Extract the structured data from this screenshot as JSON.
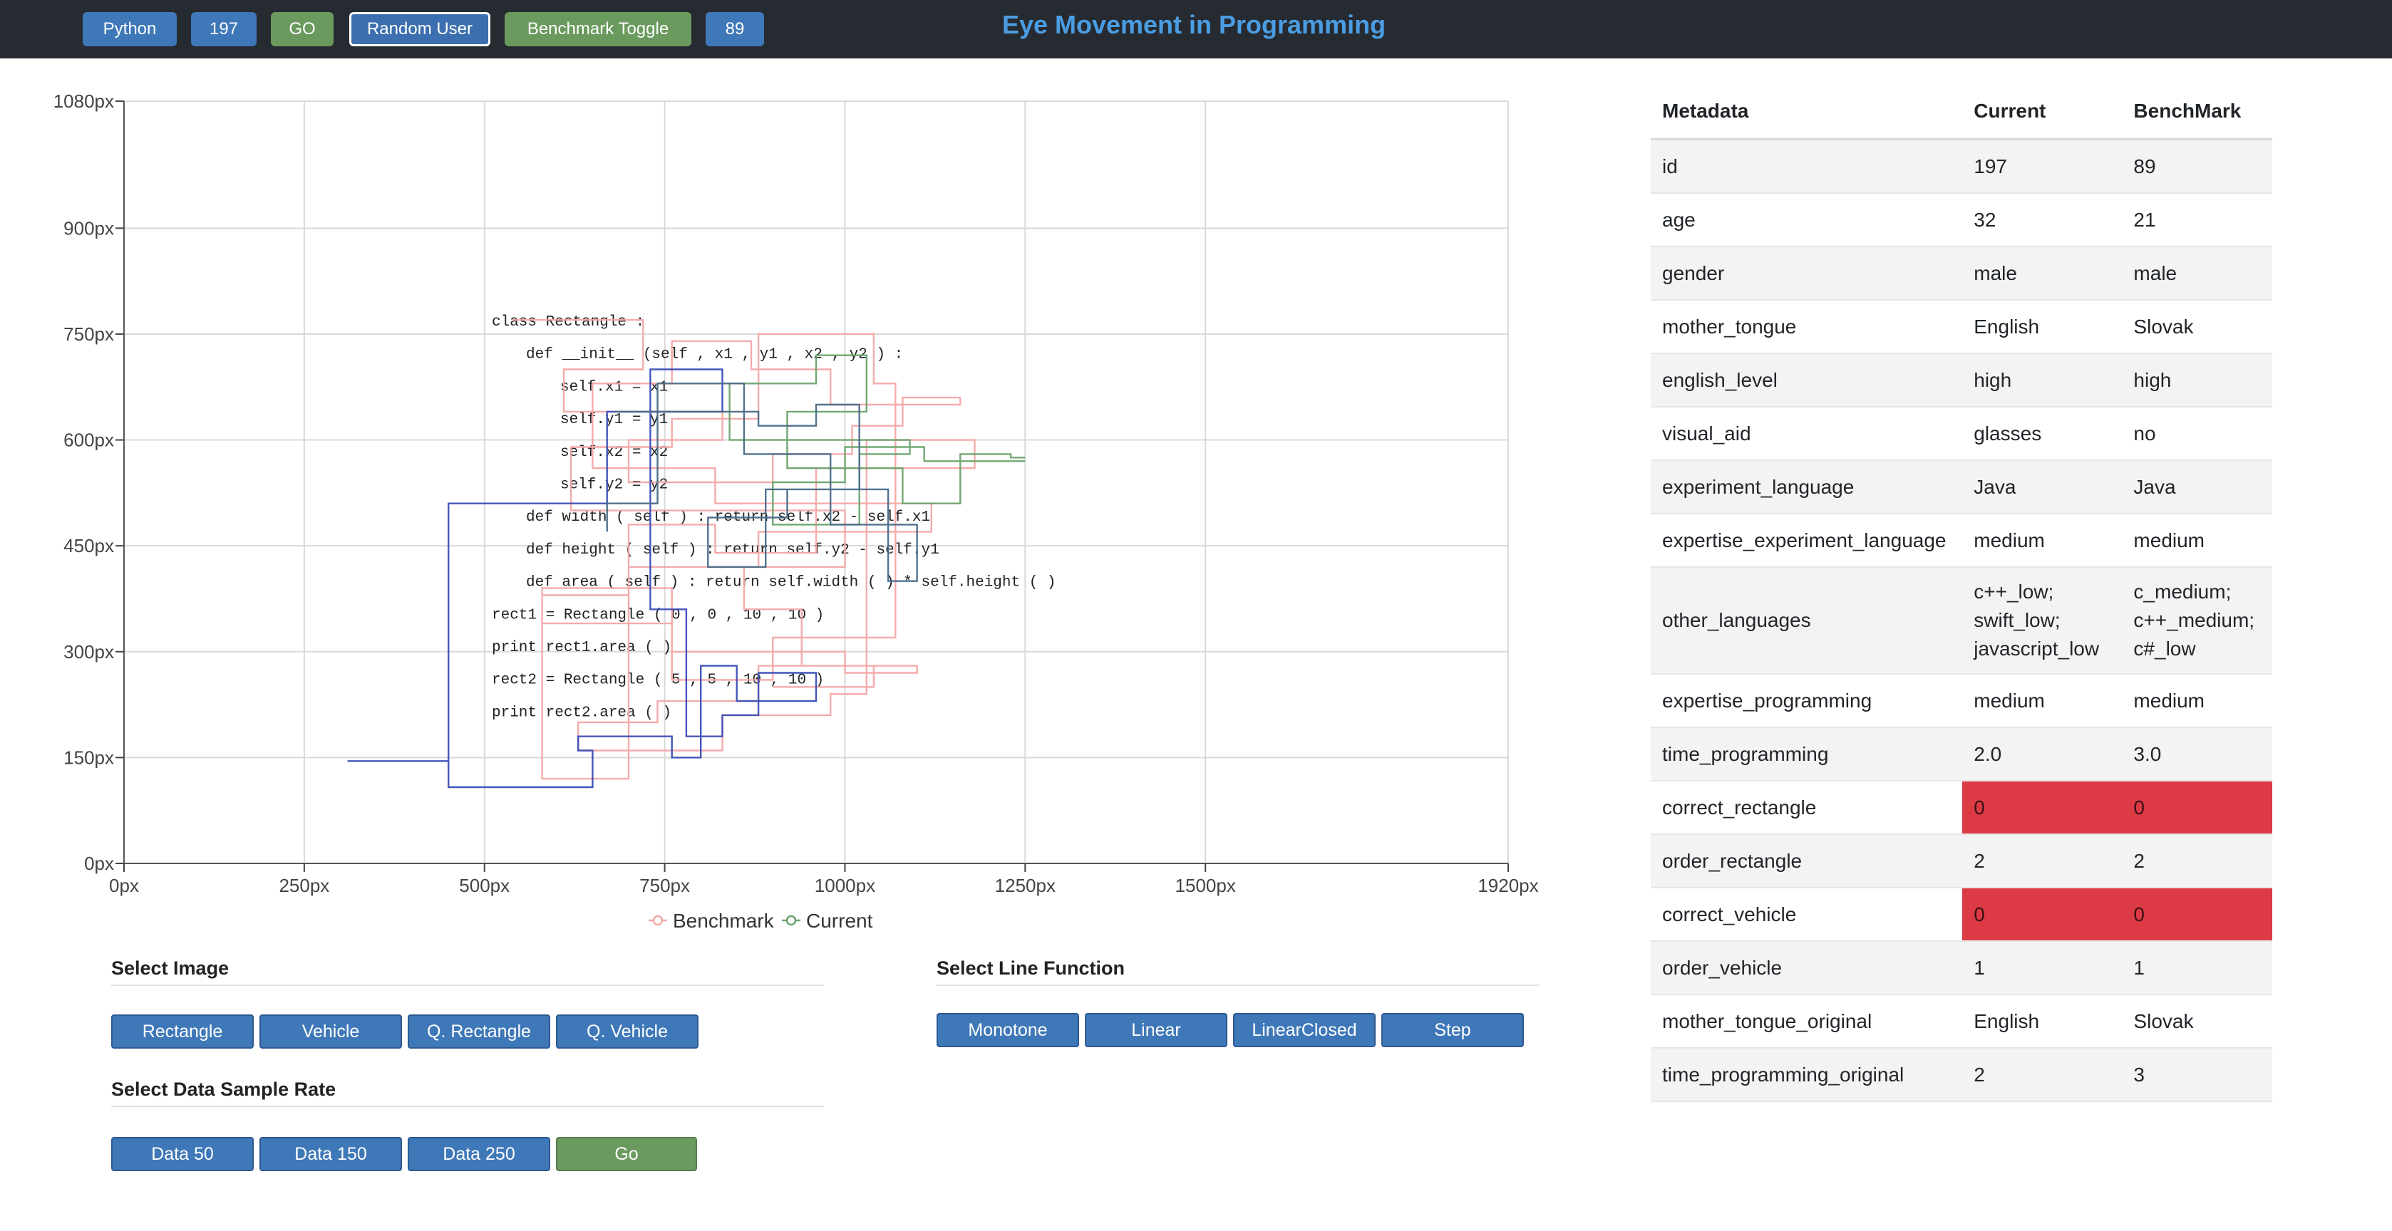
{
  "navbar": {
    "language_button": "Python",
    "current_id_button": "197",
    "go_button": "GO",
    "random_user_button": "Random User",
    "benchmark_toggle_button": "Benchmark Toggle",
    "benchmark_id_button": "89",
    "title": "Eye Movement in Programming",
    "colors": {
      "bar": "#262a31",
      "title": "#4a9de2",
      "blue": "#3f78b8",
      "green": "#6b9a5e"
    }
  },
  "chart_data": {
    "type": "line",
    "x_ticks": [
      "0px",
      "250px",
      "500px",
      "750px",
      "1000px",
      "1250px",
      "1500px",
      "1920px"
    ],
    "y_ticks": [
      "0px",
      "150px",
      "300px",
      "450px",
      "600px",
      "750px",
      "900px",
      "1080px"
    ],
    "xlim": [
      0,
      1920
    ],
    "ylim": [
      0,
      1080
    ],
    "grid": true,
    "legend_position": "bottom-center",
    "series": [
      {
        "name": "Benchmark",
        "color": "#f4a7a7",
        "curve": "step",
        "points": [
          [
            540,
            770
          ],
          [
            720,
            770
          ],
          [
            720,
            700
          ],
          [
            610,
            700
          ],
          [
            610,
            640
          ],
          [
            830,
            640
          ],
          [
            830,
            600
          ],
          [
            700,
            600
          ],
          [
            700,
            540
          ],
          [
            900,
            540
          ],
          [
            900,
            580
          ],
          [
            1010,
            580
          ],
          [
            1010,
            620
          ],
          [
            1080,
            620
          ],
          [
            1080,
            660
          ],
          [
            1160,
            660
          ],
          [
            1160,
            650
          ],
          [
            980,
            650
          ],
          [
            980,
            700
          ],
          [
            870,
            700
          ],
          [
            870,
            740
          ],
          [
            760,
            740
          ],
          [
            760,
            680
          ],
          [
            650,
            680
          ],
          [
            650,
            560
          ],
          [
            820,
            560
          ],
          [
            820,
            510
          ],
          [
            1120,
            510
          ],
          [
            1120,
            470
          ],
          [
            880,
            470
          ],
          [
            880,
            420
          ],
          [
            700,
            420
          ],
          [
            700,
            380
          ],
          [
            580,
            380
          ],
          [
            580,
            340
          ],
          [
            760,
            340
          ],
          [
            760,
            300
          ],
          [
            1000,
            300
          ],
          [
            1000,
            270
          ],
          [
            1100,
            270
          ],
          [
            1100,
            280
          ],
          [
            880,
            280
          ],
          [
            880,
            230
          ],
          [
            740,
            230
          ],
          [
            740,
            200
          ],
          [
            630,
            200
          ],
          [
            630,
            160
          ],
          [
            830,
            160
          ],
          [
            830,
            210
          ],
          [
            980,
            210
          ],
          [
            980,
            240
          ],
          [
            1030,
            240
          ],
          [
            1030,
            600
          ],
          [
            1180,
            600
          ],
          [
            1180,
            560
          ],
          [
            960,
            560
          ],
          [
            960,
            440
          ],
          [
            820,
            440
          ],
          [
            820,
            480
          ],
          [
            700,
            480
          ],
          [
            700,
            120
          ],
          [
            580,
            120
          ],
          [
            580,
            390
          ],
          [
            760,
            390
          ],
          [
            760,
            260
          ],
          [
            900,
            260
          ],
          [
            900,
            320
          ],
          [
            1070,
            320
          ],
          [
            1070,
            680
          ],
          [
            1040,
            680
          ],
          [
            1040,
            750
          ],
          [
            880,
            750
          ],
          [
            880,
            630
          ],
          [
            760,
            630
          ],
          [
            760,
            590
          ],
          [
            620,
            590
          ],
          [
            620,
            500
          ],
          [
            1000,
            500
          ],
          [
            1000,
            420
          ],
          [
            860,
            420
          ],
          [
            860,
            360
          ],
          [
            940,
            360
          ],
          [
            940,
            280
          ],
          [
            1040,
            280
          ],
          [
            1040,
            250
          ],
          [
            900,
            250
          ]
        ]
      },
      {
        "name": "Current",
        "color": "#6aa36b",
        "curve": "step",
        "points": [
          [
            1250,
            570
          ],
          [
            1110,
            570
          ],
          [
            1110,
            590
          ],
          [
            1000,
            590
          ],
          [
            1000,
            540
          ],
          [
            900,
            540
          ],
          [
            900,
            480
          ],
          [
            1020,
            480
          ],
          [
            1020,
            580
          ],
          [
            1090,
            580
          ],
          [
            1090,
            600
          ],
          [
            840,
            600
          ],
          [
            840,
            680
          ],
          [
            960,
            680
          ],
          [
            960,
            720
          ],
          [
            1030,
            720
          ],
          [
            1030,
            640
          ],
          [
            920,
            640
          ],
          [
            920,
            560
          ],
          [
            1080,
            560
          ],
          [
            1080,
            510
          ],
          [
            1160,
            510
          ],
          [
            1160,
            580
          ],
          [
            1230,
            580
          ],
          [
            1230,
            575
          ],
          [
            1250,
            575
          ]
        ]
      },
      {
        "name": "",
        "color": "#3a4db6",
        "curve": "step",
        "points": [
          [
            310,
            145
          ],
          [
            450,
            145
          ],
          [
            450,
            108
          ],
          [
            650,
            108
          ],
          [
            650,
            160
          ],
          [
            630,
            160
          ],
          [
            630,
            180
          ],
          [
            760,
            180
          ],
          [
            760,
            150
          ],
          [
            800,
            150
          ],
          [
            800,
            280
          ],
          [
            850,
            280
          ],
          [
            850,
            230
          ],
          [
            960,
            230
          ],
          [
            960,
            270
          ],
          [
            880,
            270
          ],
          [
            880,
            210
          ],
          [
            830,
            210
          ],
          [
            830,
            180
          ],
          [
            780,
            180
          ],
          [
            780,
            360
          ],
          [
            730,
            360
          ],
          [
            730,
            700
          ],
          [
            830,
            700
          ],
          [
            830,
            640
          ],
          [
            670,
            640
          ],
          [
            670,
            510
          ],
          [
            450,
            510
          ],
          [
            450,
            110
          ]
        ]
      },
      {
        "name": "",
        "color": "#4a6a88",
        "curve": "step",
        "points": [
          [
            680,
            640
          ],
          [
            880,
            640
          ],
          [
            880,
            620
          ],
          [
            960,
            620
          ],
          [
            960,
            650
          ],
          [
            1020,
            650
          ],
          [
            1020,
            530
          ],
          [
            920,
            530
          ],
          [
            920,
            490
          ],
          [
            810,
            490
          ],
          [
            810,
            420
          ],
          [
            890,
            420
          ],
          [
            890,
            530
          ],
          [
            1060,
            530
          ],
          [
            1060,
            400
          ],
          [
            1100,
            400
          ],
          [
            1100,
            480
          ],
          [
            980,
            480
          ],
          [
            980,
            580
          ],
          [
            860,
            580
          ],
          [
            860,
            680
          ],
          [
            740,
            680
          ],
          [
            740,
            510
          ],
          [
            670,
            510
          ],
          [
            670,
            470
          ]
        ]
      }
    ]
  },
  "code_lines": [
    "class Rectangle :",
    "def __init__ (self , x1 , y1 , x2 , y2 ) :",
    "self.x1 = x1",
    "self.y1 = y1",
    "self.x2 = x2",
    "self.y2 = y2",
    "def width ( self ) : return self.x2 - self.x1",
    "def height ( self ) : return self.y2 - self.y1",
    "def area ( self ) : return self.width ( ) * self.height ( )",
    "rect1 = Rectangle ( 0 , 0 , 10 , 10 )",
    "print rect1.area ( )",
    "rect2 = Rectangle ( 5 , 5 , 10 , 10 )",
    "print rect2.area ( )"
  ],
  "select_image": {
    "title": "Select Image",
    "buttons": [
      "Rectangle",
      "Vehicle",
      "Q. Rectangle",
      "Q. Vehicle"
    ]
  },
  "select_line_function": {
    "title": "Select Line Function",
    "buttons": [
      "Monotone",
      "Linear",
      "LinearClosed",
      "Step"
    ]
  },
  "select_sample_rate": {
    "title": "Select Data Sample Rate",
    "buttons": [
      "Data 50",
      "Data 150",
      "Data 250",
      "Go"
    ]
  },
  "metadata_table": {
    "headers": [
      "Metadata",
      "Current",
      "BenchMark"
    ],
    "alert_color": "#dc3b45",
    "rows": [
      {
        "key": "id",
        "current": "197",
        "benchmark": "89",
        "alert": false
      },
      {
        "key": "age",
        "current": "32",
        "benchmark": "21",
        "alert": false
      },
      {
        "key": "gender",
        "current": "male",
        "benchmark": "male",
        "alert": false
      },
      {
        "key": "mother_tongue",
        "current": "English",
        "benchmark": "Slovak",
        "alert": false
      },
      {
        "key": "english_level",
        "current": "high",
        "benchmark": "high",
        "alert": false
      },
      {
        "key": "visual_aid",
        "current": "glasses",
        "benchmark": "no",
        "alert": false
      },
      {
        "key": "experiment_language",
        "current": "Java",
        "benchmark": "Java",
        "alert": false
      },
      {
        "key": "expertise_experiment_language",
        "current": "medium",
        "benchmark": "medium",
        "alert": false
      },
      {
        "key": "other_languages",
        "current": "c++_low; swift_low; javascript_low",
        "benchmark": "c_medium; c++_medium; c#_low",
        "alert": false
      },
      {
        "key": "expertise_programming",
        "current": "medium",
        "benchmark": "medium",
        "alert": false
      },
      {
        "key": "time_programming",
        "current": "2.0",
        "benchmark": "3.0",
        "alert": false
      },
      {
        "key": "correct_rectangle",
        "current": "0",
        "benchmark": "0",
        "alert": true
      },
      {
        "key": "order_rectangle",
        "current": "2",
        "benchmark": "2",
        "alert": false
      },
      {
        "key": "correct_vehicle",
        "current": "0",
        "benchmark": "0",
        "alert": true
      },
      {
        "key": "order_vehicle",
        "current": "1",
        "benchmark": "1",
        "alert": false
      },
      {
        "key": "mother_tongue_original",
        "current": "English",
        "benchmark": "Slovak",
        "alert": false
      },
      {
        "key": "time_programming_original",
        "current": "2",
        "benchmark": "3",
        "alert": false
      }
    ]
  }
}
